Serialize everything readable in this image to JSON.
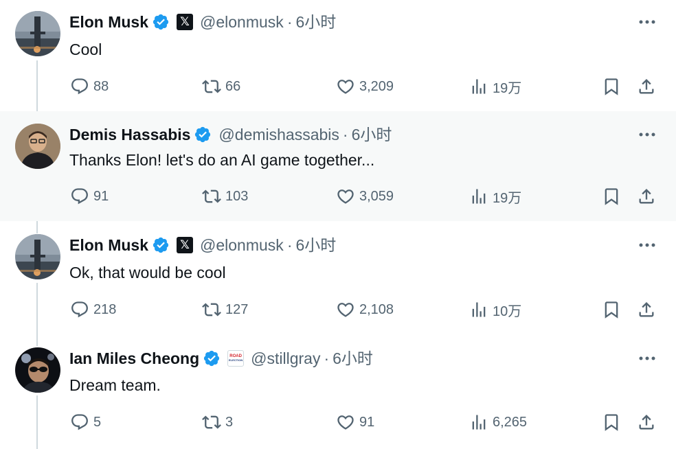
{
  "colors": {
    "text": "#0f1419",
    "secondary": "#536471",
    "verified": "#1d9bf0",
    "thread_line": "#cfd9de",
    "highlight_bg": "#f7f9f9"
  },
  "tweets": [
    {
      "author": "Elon Musk",
      "handle": "@elonmusk",
      "separator": "·",
      "time": "6小时",
      "text": "Cool",
      "affiliate_badge": "x-logo-badge",
      "avatar": "starship-avatar",
      "stats": {
        "replies": "88",
        "reposts": "66",
        "likes": "3,209",
        "views": "19万"
      }
    },
    {
      "author": "Demis Hassabis",
      "handle": "@demishassabis",
      "separator": "·",
      "time": "6小时",
      "text": "Thanks Elon! let's do an AI game together...",
      "affiliate_badge": "",
      "avatar": "person-avatar",
      "stats": {
        "replies": "91",
        "reposts": "103",
        "likes": "3,059",
        "views": "19万"
      }
    },
    {
      "author": "Elon Musk",
      "handle": "@elonmusk",
      "separator": "·",
      "time": "6小时",
      "text": "Ok, that would be cool",
      "affiliate_badge": "x-logo-badge",
      "avatar": "starship-avatar",
      "stats": {
        "replies": "218",
        "reposts": "127",
        "likes": "2,108",
        "views": "10万"
      }
    },
    {
      "author": "Ian Miles Cheong",
      "handle": "@stillgray",
      "separator": "·",
      "time": "6小时",
      "text": "Dream team.",
      "affiliate_badge": "road-election-badge",
      "avatar": "person-sunglasses-avatar",
      "stats": {
        "replies": "5",
        "reposts": "3",
        "likes": "91",
        "views": "6,265"
      }
    }
  ],
  "badges": {
    "x_glyph": "𝕏",
    "road_top": "ROAD",
    "road_bottom": "ELECTION"
  }
}
